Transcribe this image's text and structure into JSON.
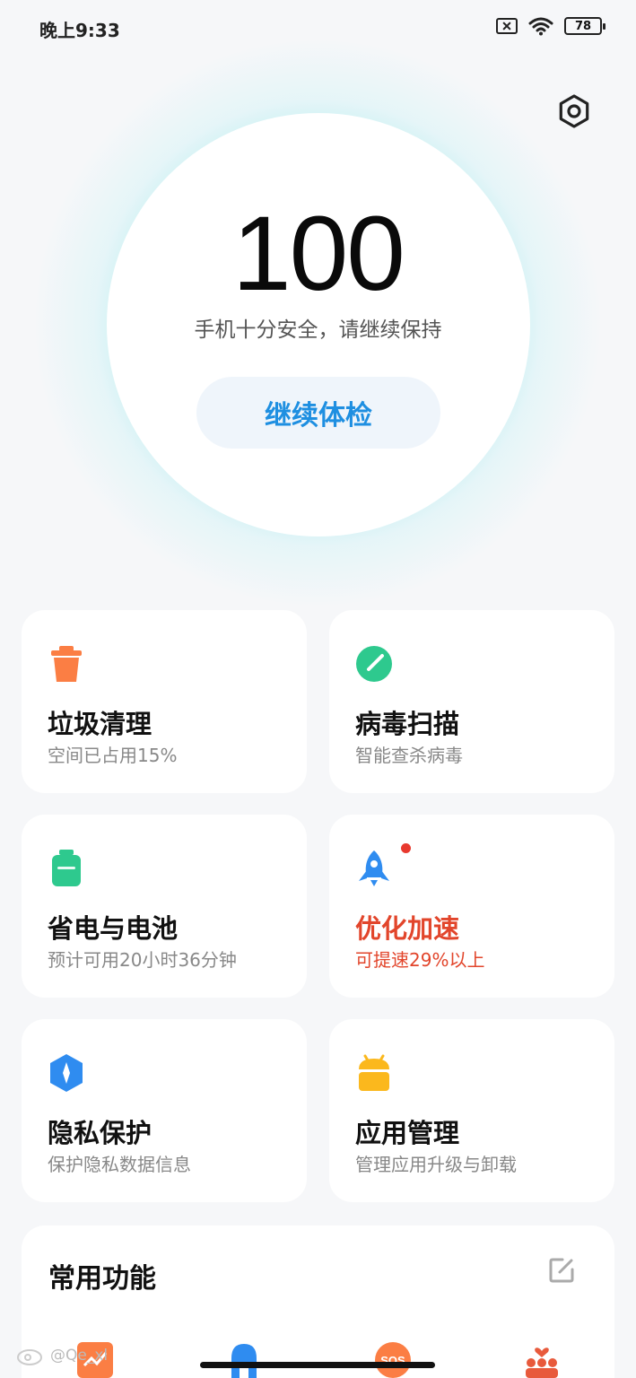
{
  "status_bar": {
    "time": "晚上9:33",
    "battery": "78"
  },
  "hero": {
    "score": "100",
    "description": "手机十分安全，请继续保持",
    "check_button": "继续体检"
  },
  "cards": [
    {
      "title": "垃圾清理",
      "subtitle": "空间已占用15%",
      "icon": "trash-icon",
      "color": "#fb7e44"
    },
    {
      "title": "病毒扫描",
      "subtitle": "智能查杀病毒",
      "icon": "virus-scan-icon",
      "color": "#2ec98e"
    },
    {
      "title": "省电与电池",
      "subtitle": "预计可用20小时36分钟",
      "icon": "battery-icon",
      "color": "#2ec98e"
    },
    {
      "title": "优化加速",
      "subtitle": "可提速29%以上",
      "icon": "rocket-icon",
      "color": "#2f8cf0",
      "alert_color": "#e2452b"
    },
    {
      "title": "隐私保护",
      "subtitle": "保护隐私数据信息",
      "icon": "privacy-shield-icon",
      "color": "#2f8cf0"
    },
    {
      "title": "应用管理",
      "subtitle": "管理应用升级与卸载",
      "icon": "app-manager-icon",
      "color": "#fbb81d"
    }
  ],
  "common_functions": {
    "title": "常用功能"
  },
  "watermark": "@Qe_xl"
}
